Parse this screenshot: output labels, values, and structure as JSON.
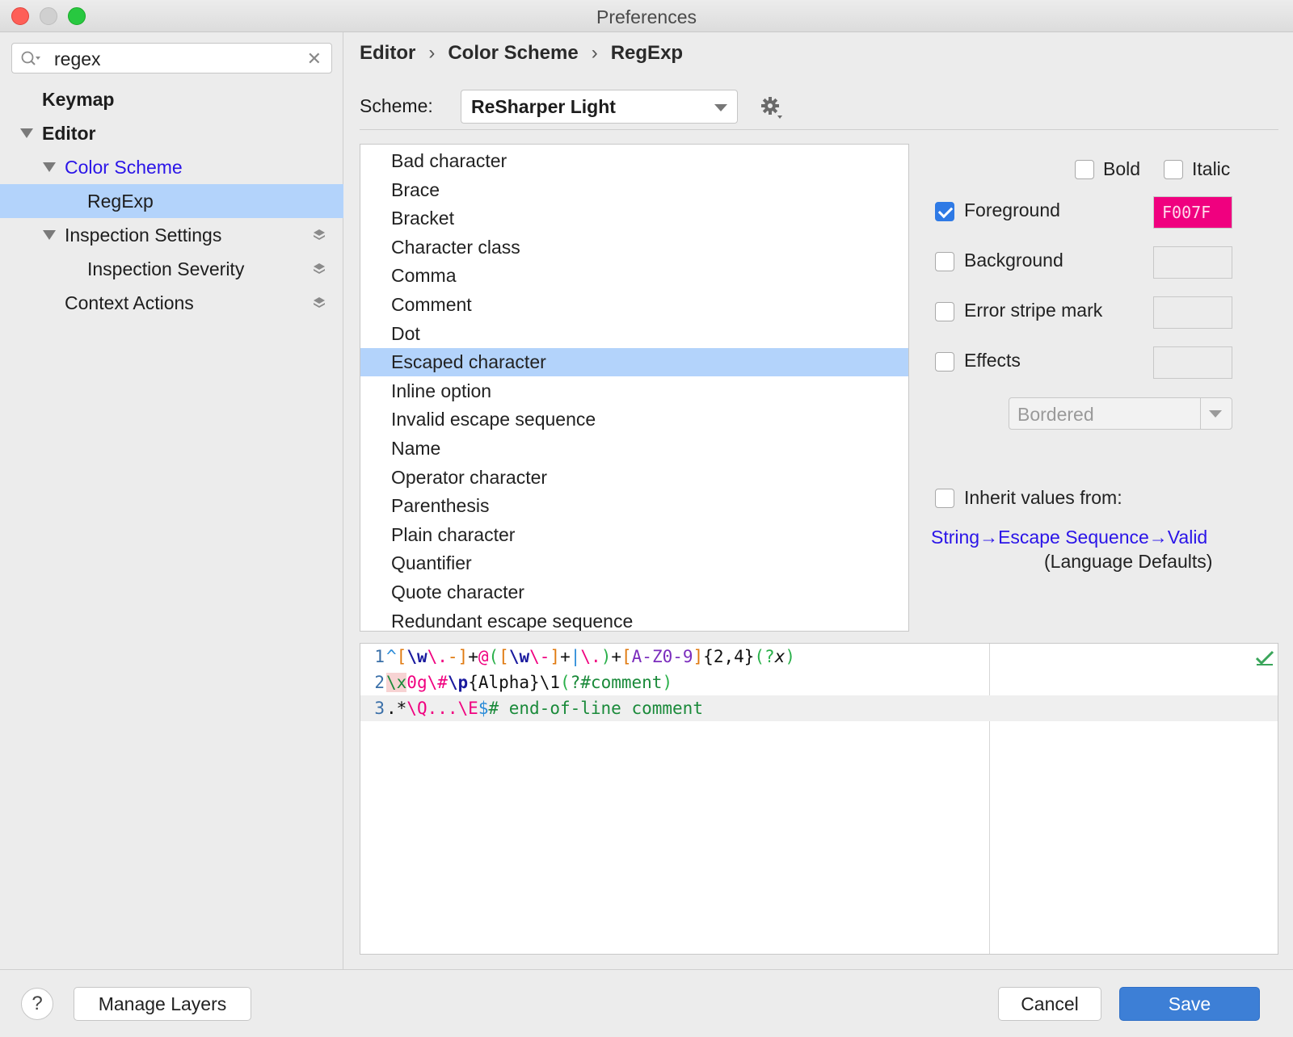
{
  "window": {
    "title": "Preferences"
  },
  "search": {
    "value": "regex"
  },
  "sidebar": {
    "items": [
      {
        "label": "Keymap"
      },
      {
        "label": "Editor"
      },
      {
        "label": "Color Scheme"
      },
      {
        "label": "RegExp"
      },
      {
        "label": "Inspection Settings"
      },
      {
        "label": "Inspection Severity"
      },
      {
        "label": "Context Actions"
      }
    ]
  },
  "breadcrumb": {
    "items": [
      "Editor",
      "Color Scheme",
      "RegExp"
    ],
    "separator": "›"
  },
  "scheme": {
    "label": "Scheme:",
    "selected": "ReSharper Light"
  },
  "elements": {
    "items": [
      "Bad character",
      "Brace",
      "Bracket",
      "Character class",
      "Comma",
      "Comment",
      "Dot",
      "Escaped character",
      "Inline option",
      "Invalid escape sequence",
      "Name",
      "Operator character",
      "Parenthesis",
      "Plain character",
      "Quantifier",
      "Quote character",
      "Redundant escape sequence"
    ],
    "selected_index": 7
  },
  "attributes": {
    "bold": {
      "label": "Bold",
      "checked": false
    },
    "italic": {
      "label": "Italic",
      "checked": false
    },
    "foreground": {
      "label": "Foreground",
      "checked": true,
      "value": "F007F",
      "color": "#f0007f"
    },
    "background": {
      "label": "Background",
      "checked": false
    },
    "error_stripe": {
      "label": "Error stripe mark",
      "checked": false
    },
    "effects": {
      "label": "Effects",
      "checked": false,
      "style": "Bordered"
    },
    "inherit": {
      "label": "Inherit values from:",
      "checked": false,
      "link": "String→Escape Sequence→Valid",
      "sub": "(Language Defaults)"
    }
  },
  "preview": {
    "line_numbers": [
      "1",
      "2",
      "3"
    ],
    "current_line": 3
  },
  "footer": {
    "help": "?",
    "manage_layers": "Manage Layers",
    "cancel": "Cancel",
    "save": "Save"
  }
}
